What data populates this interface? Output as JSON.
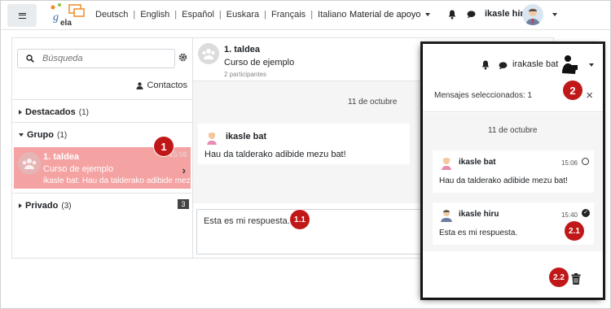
{
  "nav": {
    "languages": [
      "Deutsch",
      "English",
      "Español",
      "Euskara",
      "Français",
      "Italiano"
    ],
    "material_label": "Material de apoyo",
    "user_name": "ikasle hiru"
  },
  "sidebar": {
    "search_placeholder": "Búsqueda",
    "contacts_label": "Contactos",
    "sections": [
      {
        "label": "Destacados",
        "count": "(1)"
      },
      {
        "label": "Grupo",
        "count": "(1)"
      },
      {
        "label": "Privado",
        "count": "(3)",
        "badge": "3"
      }
    ],
    "conversation": {
      "name": "1. taldea",
      "course": "Curso de ejemplo",
      "time": "15:06",
      "last_sender": "ikasle bat:",
      "last_text": "Hau da talderako adibide mezu bat!"
    }
  },
  "conversation": {
    "title": "1. taldea",
    "course": "Curso de ejemplo",
    "participants": "2 participantes",
    "date": "11 de octubre",
    "message": {
      "sender": "ikasle bat",
      "text": "Hau da talderako adibide mezu bat!"
    },
    "compose_value": "Esta es mi respuesta."
  },
  "drawer": {
    "user_name": "irakasle bat",
    "selected_text": "Mensajes seleccionados: 1",
    "close_glyph": "×",
    "date": "11 de octubre",
    "messages": [
      {
        "sender": "ikasle bat",
        "time": "15:06",
        "text": "Hau da talderako adibide mezu bat!"
      },
      {
        "sender": "ikasle hiru",
        "time": "15:40",
        "text": "Esta es mi respuesta."
      }
    ]
  },
  "markers": {
    "m1": "1",
    "m11": "1.1",
    "m2": "2",
    "m21": "2.1",
    "m22": "2.2"
  },
  "colors": {
    "selected_conversation": "#f4a2a2",
    "marker": "#c01818"
  }
}
